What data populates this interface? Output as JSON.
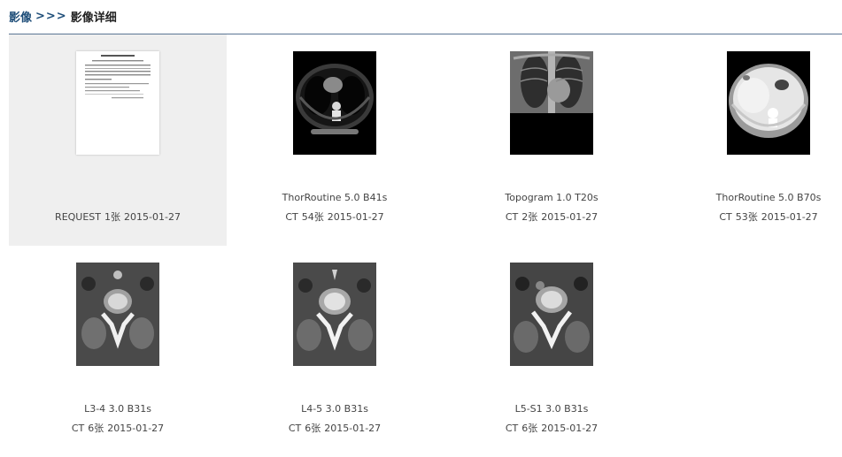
{
  "breadcrumb": {
    "parent": "影像",
    "separator": ">>>",
    "current": "影像详细"
  },
  "colors": {
    "accent": "#1f4e79",
    "divider": "#5a7594",
    "selected_bg": "#efefef"
  },
  "studies": [
    {
      "label": "",
      "modality": "REQUEST",
      "count": "1张",
      "date": "2015-01-27",
      "thumb": "document",
      "selected": true
    },
    {
      "label": "ThorRoutine 5.0 B41s",
      "modality": "CT",
      "count": "54张",
      "date": "2015-01-27",
      "thumb": "chest-axial",
      "selected": false
    },
    {
      "label": "Topogram 1.0 T20s",
      "modality": "CT",
      "count": "2张",
      "date": "2015-01-27",
      "thumb": "topogram",
      "selected": false
    },
    {
      "label": "ThorRoutine 5.0 B70s",
      "modality": "CT",
      "count": "53张",
      "date": "2015-01-27",
      "thumb": "lung-window",
      "selected": false
    },
    {
      "label": "L3-4 3.0 B31s",
      "modality": "CT",
      "count": "6张",
      "date": "2015-01-27",
      "thumb": "spine-axial",
      "selected": false
    },
    {
      "label": "L4-5 3.0 B31s",
      "modality": "CT",
      "count": "6张",
      "date": "2015-01-27",
      "thumb": "spine-axial",
      "selected": false
    },
    {
      "label": "L5-S1 3.0 B31s",
      "modality": "CT",
      "count": "6张",
      "date": "2015-01-27",
      "thumb": "spine-axial",
      "selected": false
    }
  ]
}
